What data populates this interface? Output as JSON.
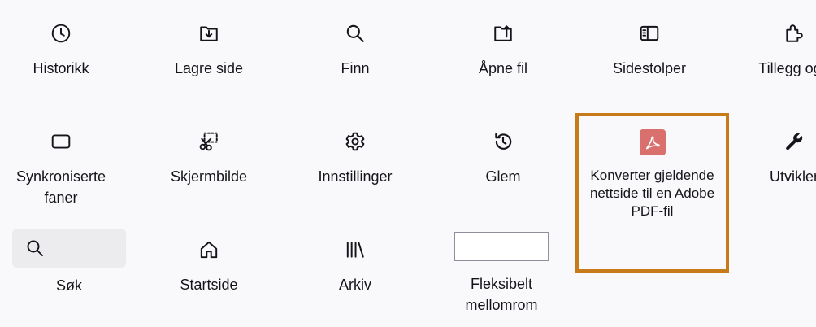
{
  "toolbar_items": {
    "history": {
      "label": "Historikk",
      "icon": "clock-icon"
    },
    "save_page": {
      "label": "Lagre side",
      "icon": "save-page-icon"
    },
    "find": {
      "label": "Finn",
      "icon": "search-icon"
    },
    "open_file": {
      "label": "Åpne fil",
      "icon": "open-file-icon"
    },
    "sidebars": {
      "label": "Sidestolper",
      "icon": "sidebar-icon"
    },
    "addons": {
      "label": "Tillegg og t",
      "icon": "puzzle-icon"
    },
    "synced_tabs": {
      "label": "Synkroniserte\nfaner",
      "icon": "synced-tabs-icon"
    },
    "screenshot": {
      "label": "Skjermbilde",
      "icon": "screenshot-icon"
    },
    "settings": {
      "label": "Innstillinger",
      "icon": "gear-icon"
    },
    "forget": {
      "label": "Glem",
      "icon": "forget-icon"
    },
    "convert_pdf": {
      "label": "Konverter gjeldende nettside til en Adobe PDF-fil",
      "icon": "adobe-pdf-icon",
      "accent": "#d9706e",
      "highlight_color": "#c77a19"
    },
    "developer": {
      "label": "Utvikler",
      "icon": "wrench-icon"
    },
    "search": {
      "label": "Søk",
      "icon": "search-icon"
    },
    "home": {
      "label": "Startside",
      "icon": "home-icon"
    },
    "library": {
      "label": "Arkiv",
      "icon": "library-icon"
    },
    "flexible_space": {
      "label": "Fleksibelt\nmellomrom",
      "icon": "flexible-space"
    }
  }
}
